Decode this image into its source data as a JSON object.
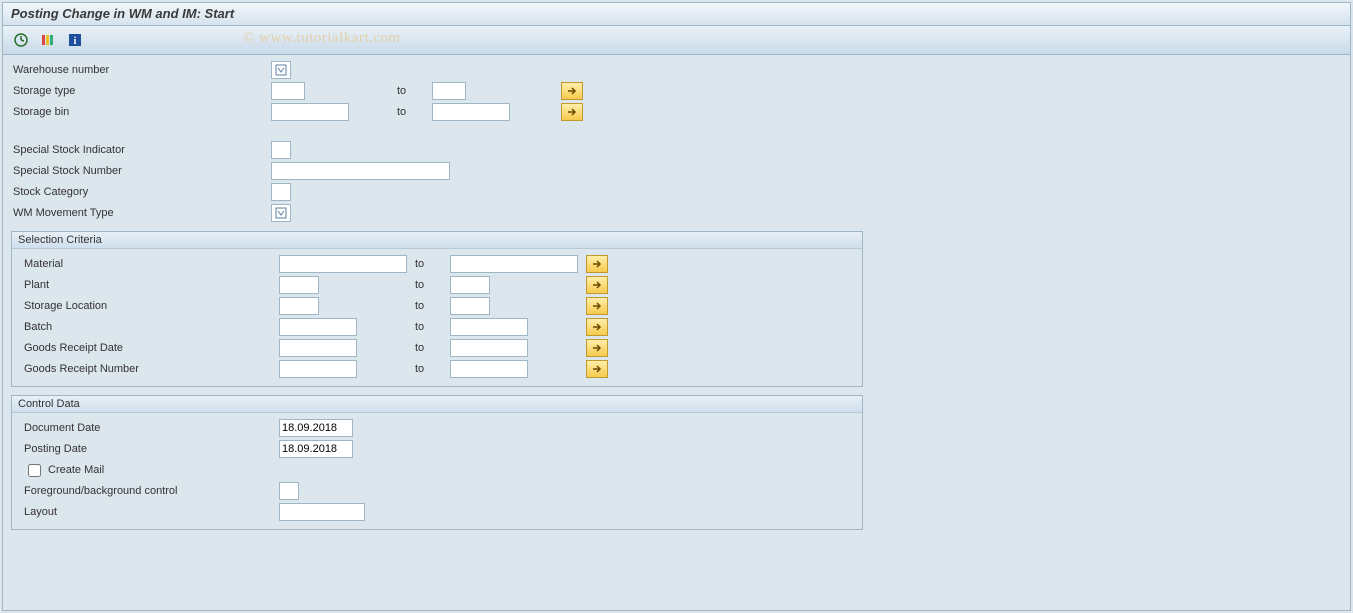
{
  "title": "Posting Change in WM and IM: Start",
  "watermark": "© www.tutorialkart.com",
  "labels": {
    "to": "to",
    "warehouse_number": "Warehouse number",
    "storage_type": "Storage type",
    "storage_bin": "Storage bin",
    "special_stock_indicator": "Special Stock Indicator",
    "special_stock_number": "Special Stock Number",
    "stock_category": "Stock Category",
    "wm_movement_type": "WM Movement Type"
  },
  "groups": {
    "selection": {
      "title": "Selection Criteria",
      "material": "Material",
      "plant": "Plant",
      "storage_location": "Storage Location",
      "batch": "Batch",
      "goods_receipt_date": "Goods Receipt Date",
      "goods_receipt_number": "Goods Receipt Number"
    },
    "control": {
      "title": "Control Data",
      "document_date": "Document Date",
      "posting_date": "Posting Date",
      "create_mail": "Create Mail",
      "fg_bg_control": "Foreground/background control",
      "layout": "Layout"
    }
  },
  "values": {
    "warehouse_number": "",
    "storage_type_from": "",
    "storage_type_to": "",
    "storage_bin_from": "",
    "storage_bin_to": "",
    "special_stock_indicator": "",
    "special_stock_number": "",
    "stock_category": "",
    "wm_movement_type": "",
    "material_from": "",
    "material_to": "",
    "plant_from": "",
    "plant_to": "",
    "storage_location_from": "",
    "storage_location_to": "",
    "batch_from": "",
    "batch_to": "",
    "gr_date_from": "",
    "gr_date_to": "",
    "gr_number_from": "",
    "gr_number_to": "",
    "document_date": "18.09.2018",
    "posting_date": "18.09.2018",
    "create_mail": false,
    "fg_bg_control": "",
    "layout": ""
  }
}
